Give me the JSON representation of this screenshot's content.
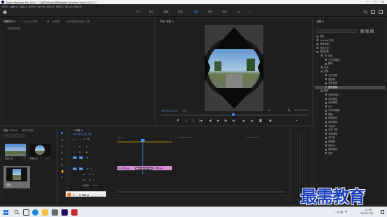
{
  "window": {
    "title": "Adobe Premiere Pro 2020 - C:\\用户\\Video\\示例\\Adobe Premiere Pro\\14.0\\111 *",
    "min": "—",
    "max": "□",
    "close": "✕"
  },
  "menu": [
    "文件(F)",
    "编辑(E)",
    "剪辑(C)",
    "序列(S)",
    "标记(M)",
    "图形(G)",
    "视图(V)",
    "窗口(W)",
    "帮助(H)"
  ],
  "workspaces": [
    "学习",
    "组件",
    "编辑",
    "颜色",
    "效果",
    "音频",
    "图形",
    "库"
  ],
  "active_workspace": "效果",
  "source_panel": {
    "tabs": [
      "效果控件 ≡",
      "Lumetri 范围",
      "源:（无剪辑）",
      "音频剪辑混合器: 字幕"
    ],
    "placeholder": "（未选择剪辑）"
  },
  "program_monitor": {
    "title": "节目: 字幕 ≡",
    "timecode_left": "00:00:01:24",
    "fit_label": "适合",
    "quality_label": "1/2",
    "timecode_right": "00:00:04:01",
    "export_button": "导出帧 (F4)"
  },
  "project_panel": {
    "tabs": [
      "项目: 111 ≡",
      "媒体浏览器"
    ],
    "items": [
      {
        "name": "天空.jpg",
        "duration": "4:29"
      },
      {
        "name": "大地.jpg",
        "duration": "4:29"
      },
      {
        "name": "字幕",
        "duration": "4:29"
      }
    ]
  },
  "timeline": {
    "title": "× 字幕 ≡",
    "timecode": "00:00:01:24",
    "ruler": [
      ":00:00",
      "00:00:05:00",
      "00:00:10:00"
    ],
    "video_tracks": [
      "V3",
      "V2",
      "V1"
    ],
    "audio_tracks": [
      "A1",
      "A2",
      "A3"
    ],
    "master_label": "主声道",
    "master_value": "0.0",
    "clips": [
      "fx 天空.jpg",
      "fx 大地.jpg"
    ],
    "tooltip": "视频切换边缘"
  },
  "effects_panel": {
    "title": "效果 ≡",
    "items": [
      {
        "label": "预设",
        "level": 0
      },
      {
        "label": "Lumetri 预设",
        "level": 0
      },
      {
        "label": "音频效果",
        "level": 0
      },
      {
        "label": "音频过渡",
        "level": 0
      },
      {
        "label": "视频效果",
        "level": 0
      },
      {
        "label": "3D 运动",
        "level": 1
      },
      {
        "label": "立方体旋转",
        "level": 2
      },
      {
        "label": "翻转",
        "level": 2
      },
      {
        "label": "内滑",
        "level": 1
      },
      {
        "label": "划像",
        "level": 1
      },
      {
        "label": "交叉划像",
        "level": 2
      },
      {
        "label": "圆划像",
        "level": 2
      },
      {
        "label": "盒形划像",
        "level": 2
      },
      {
        "label": "菱形划像",
        "level": 2
      },
      {
        "label": "擦除",
        "level": 1
      },
      {
        "label": "双侧平推门",
        "level": 2
      },
      {
        "label": "带状擦除",
        "level": 2
      },
      {
        "label": "径向擦除",
        "level": 2
      },
      {
        "label": "插入",
        "level": 2
      },
      {
        "label": "时钟式擦除",
        "level": 2
      },
      {
        "label": "棋盘",
        "level": 2
      },
      {
        "label": "棋盘擦除",
        "level": 2
      },
      {
        "label": "楔形擦除",
        "level": 2
      },
      {
        "label": "水波块",
        "level": 2
      },
      {
        "label": "油漆飞溅",
        "level": 2
      },
      {
        "label": "渐变擦除",
        "level": 2
      },
      {
        "label": "百叶窗",
        "level": 2
      },
      {
        "label": "螺旋框",
        "level": 2
      },
      {
        "label": "随机块",
        "level": 2
      },
      {
        "label": "随机擦除",
        "level": 2
      },
      {
        "label": "风车",
        "level": 2
      }
    ],
    "selected_index": 13
  },
  "taskbar": {
    "time": "11:26",
    "date": "2021/11/26"
  },
  "watermark": "最需教育"
}
